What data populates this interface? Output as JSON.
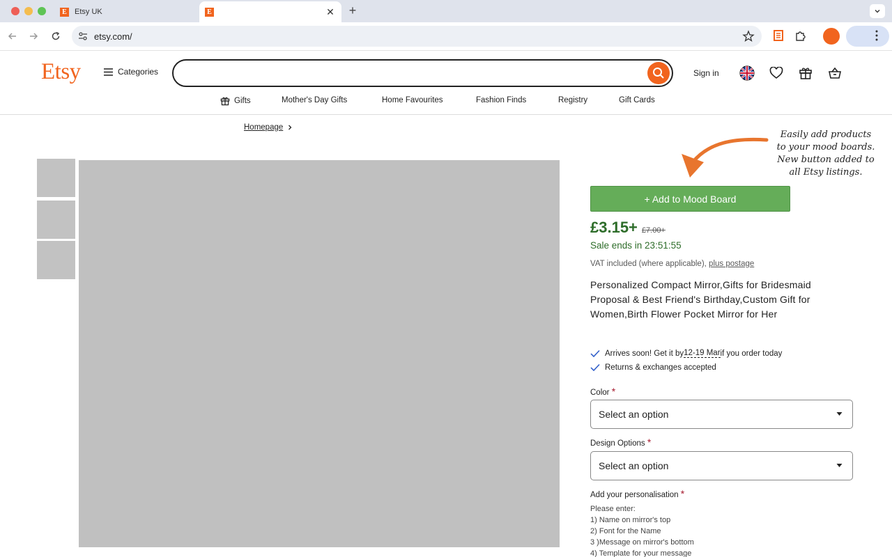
{
  "browser": {
    "tabs": [
      {
        "title": "Etsy UK",
        "favicon": "E"
      },
      {
        "title": "",
        "favicon": "E",
        "close": "✕"
      }
    ],
    "new_tab": "+",
    "url": "etsy.com/"
  },
  "header": {
    "logo": "Etsy",
    "categories": "Categories",
    "search_placeholder": "",
    "sign_in": "Sign in"
  },
  "subnav": [
    "Gifts",
    "Mother's Day Gifts",
    "Home Favourites",
    "Fashion Finds",
    "Registry",
    "Gift Cards"
  ],
  "breadcrumb": "Homepage",
  "annotation": [
    "Easily add products",
    "to your mood boards.",
    "New button added to",
    "all Etsy listings."
  ],
  "mood_board_button": "+ Add to Mood Board",
  "price": {
    "current": "£3.15+",
    "original": "£7.00+"
  },
  "sale_ends": "Sale ends in 23:51:55",
  "vat": {
    "text": "VAT included (where applicable), ",
    "link": "plus postage"
  },
  "product_title": "Personalized Compact Mirror,Gifts for Bridesmaid Proposal & Best Friend's Birthday,Custom Gift for Women,Birth Flower Pocket Mirror for Her",
  "delivery": {
    "prefix": "Arrives soon! Get it by ",
    "dates": "12-19 Mar",
    "suffix": " if you order today"
  },
  "returns": "Returns & exchanges accepted",
  "options": {
    "color_label": "Color",
    "color_value": "Select an option",
    "design_label": "Design Options",
    "design_value": "Select an option",
    "personalisation_label": "Add your personalisation",
    "required_mark": "*"
  },
  "instructions": [
    "Please enter:",
    "1) Name on mirror's top",
    "2) Font for the Name",
    "3 )Message on mirror's bottom",
    "4) Template for your message"
  ],
  "colors": {
    "brand": "#f1641e",
    "mood_button": "#65ad59",
    "price": "#2e6d2a"
  }
}
